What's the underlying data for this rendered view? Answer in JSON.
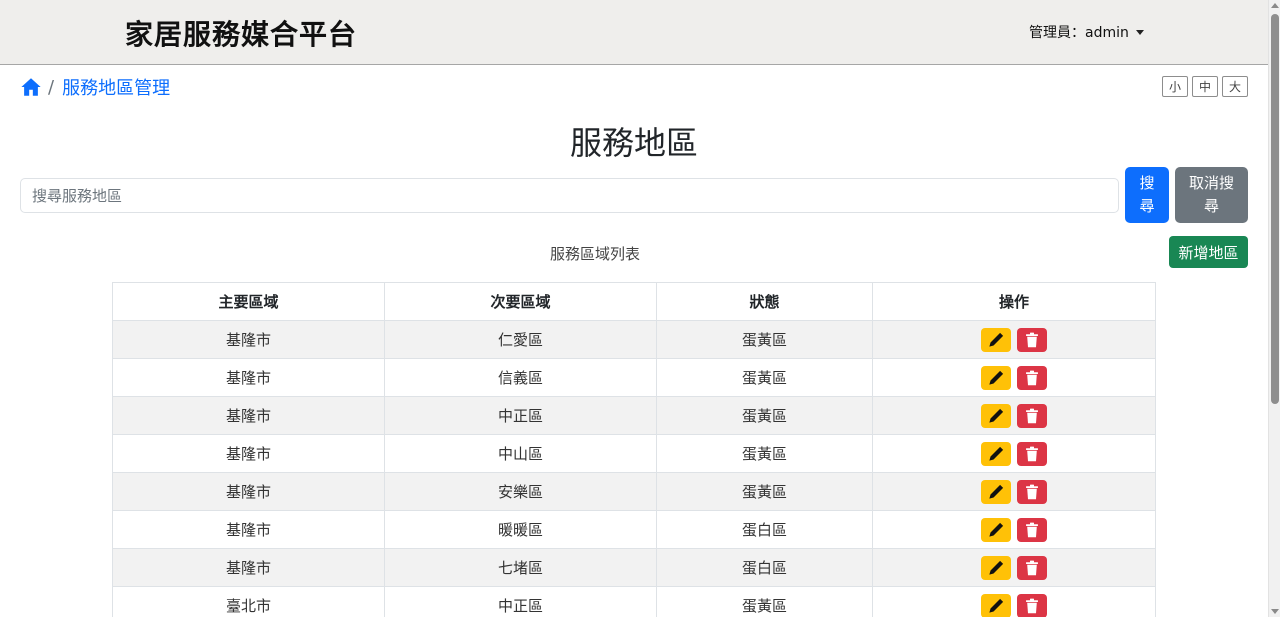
{
  "header": {
    "brand": "家居服務媒合平台",
    "user_menu": "管理員：admin"
  },
  "breadcrumb": {
    "current": "服務地區管理"
  },
  "font_size": {
    "small": "小",
    "medium": "中",
    "large": "大"
  },
  "page_title": "服務地區",
  "search": {
    "placeholder": "搜尋服務地區",
    "value": "",
    "search_label": "搜尋",
    "cancel_label": "取消搜尋"
  },
  "list": {
    "caption": "服務區域列表",
    "add_label": "新增地區",
    "columns": [
      "主要區域",
      "次要區域",
      "狀態",
      "操作"
    ],
    "rows": [
      {
        "main": "基隆市",
        "sub": "仁愛區",
        "status": "蛋黃區"
      },
      {
        "main": "基隆市",
        "sub": "信義區",
        "status": "蛋黃區"
      },
      {
        "main": "基隆市",
        "sub": "中正區",
        "status": "蛋黃區"
      },
      {
        "main": "基隆市",
        "sub": "中山區",
        "status": "蛋黃區"
      },
      {
        "main": "基隆市",
        "sub": "安樂區",
        "status": "蛋黃區"
      },
      {
        "main": "基隆市",
        "sub": "暖暖區",
        "status": "蛋白區"
      },
      {
        "main": "基隆市",
        "sub": "七堵區",
        "status": "蛋白區"
      },
      {
        "main": "臺北市",
        "sub": "中正區",
        "status": "蛋黃區"
      }
    ]
  },
  "colors": {
    "primary": "#0d6efd",
    "secondary": "#6c757d",
    "success": "#198754",
    "warning": "#ffc107",
    "danger": "#dc3545",
    "status_yolk": "#f0ad0e",
    "status_white": "#333333"
  },
  "icons": {
    "home": "home-icon",
    "caret": "chevron-down-icon",
    "edit": "pencil-icon",
    "delete": "trash-icon"
  }
}
